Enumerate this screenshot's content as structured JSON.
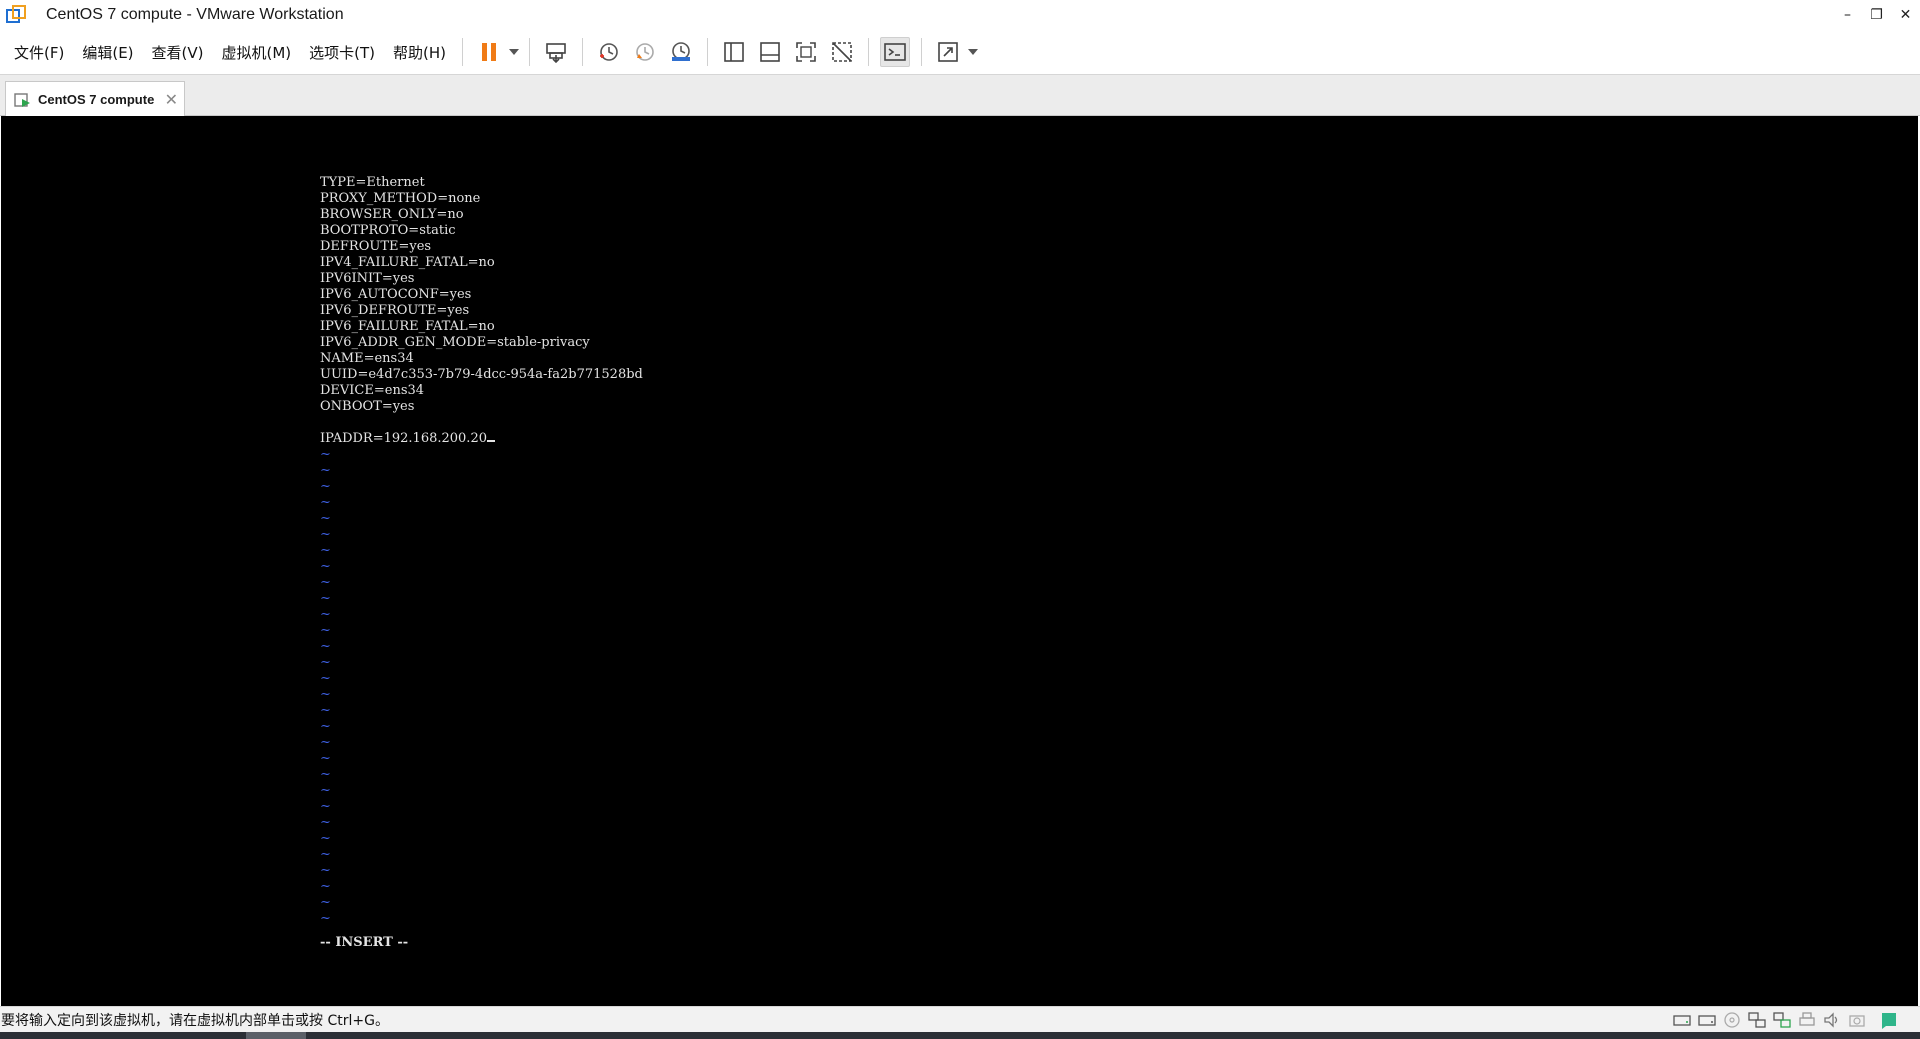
{
  "window": {
    "title": "CentOS 7 compute - VMware Workstation",
    "controls": {
      "minimize": "–",
      "restore": "❐",
      "close": "✕"
    }
  },
  "menu": {
    "items": [
      "文件(F)",
      "编辑(E)",
      "查看(V)",
      "虚拟机(M)",
      "选项卡(T)",
      "帮助(H)"
    ]
  },
  "toolbar": {
    "buttons": [
      "pause-icon",
      "send-ctrl-alt-del-icon",
      "snapshot-icon",
      "revert-snapshot-icon",
      "snapshot-manager-icon",
      "show-library-icon",
      "show-thumbnail-icon",
      "full-screen-icon",
      "unity-icon",
      "console-view-icon",
      "stretch-icon"
    ],
    "accent": "#f07b16"
  },
  "tabs": [
    {
      "label": "CentOS 7 compute",
      "close": "✕"
    }
  ],
  "terminal": {
    "lines": [
      "TYPE=Ethernet",
      "PROXY_METHOD=none",
      "BROWSER_ONLY=no",
      "BOOTPROTO=static",
      "DEFROUTE=yes",
      "IPV4_FAILURE_FATAL=no",
      "IPV6INIT=yes",
      "IPV6_AUTOCONF=yes",
      "IPV6_DEFROUTE=yes",
      "IPV6_FAILURE_FATAL=no",
      "IPV6_ADDR_GEN_MODE=stable-privacy",
      "NAME=ens34",
      "UUID=e4d7c353-7b79-4dcc-954a-fa2b771528bd",
      "DEVICE=ens34",
      "ONBOOT=yes",
      "",
      "IPADDR=192.168.200.20"
    ],
    "tilde": "~",
    "tilde_count": 30,
    "mode_line": "-- INSERT --",
    "text_color": "#e4e4e4",
    "tilde_color": "#3d5fe0",
    "background": "#000000"
  },
  "status": {
    "message": "要将输入定向到该虚拟机，请在虚拟机内部单击或按 Ctrl+G。",
    "icons": [
      "hard-disk-icon",
      "hard-disk-2-icon",
      "cd-rom-icon",
      "network-adapter-icon",
      "network-adapter-2-icon",
      "printer-icon",
      "sound-icon",
      "camera-icon",
      "message-log-icon"
    ]
  }
}
